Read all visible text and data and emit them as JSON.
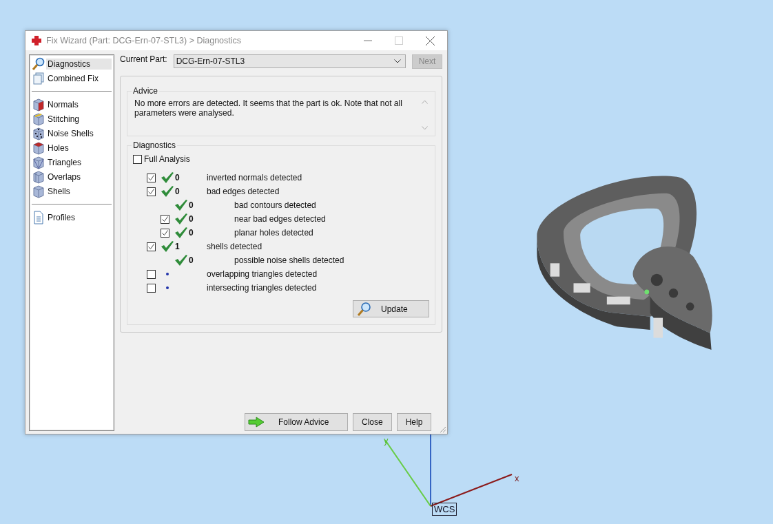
{
  "window": {
    "title": "Fix Wizard (Part: DCG-Ern-07-STL3) > Diagnostics"
  },
  "sidebar": {
    "groups": [
      {
        "items": [
          {
            "label": "Diagnostics",
            "selected": true
          },
          {
            "label": "Combined Fix",
            "selected": false
          }
        ]
      },
      {
        "items": [
          {
            "label": "Normals",
            "selected": false
          },
          {
            "label": "Stitching",
            "selected": false
          },
          {
            "label": "Noise Shells",
            "selected": false
          },
          {
            "label": "Holes",
            "selected": false
          },
          {
            "label": "Triangles",
            "selected": false
          },
          {
            "label": "Overlaps",
            "selected": false
          },
          {
            "label": "Shells",
            "selected": false
          }
        ]
      },
      {
        "items": [
          {
            "label": "Profiles",
            "selected": false
          }
        ]
      }
    ]
  },
  "current_part": {
    "label": "Current Part:",
    "value": "DCG-Ern-07-STL3"
  },
  "next_button": {
    "label": "Next",
    "disabled": true
  },
  "advice": {
    "title": "Advice",
    "text": "No more errors are detected. It seems that the part is ok. Note that not all parameters were analysed."
  },
  "diagnostics": {
    "title": "Diagnostics",
    "full_analysis": {
      "label": "Full Analysis",
      "checked": false
    },
    "rows": [
      {
        "checked": true,
        "passed": true,
        "count": "0",
        "label": "inverted normals detected"
      },
      {
        "checked": true,
        "passed": true,
        "count": "0",
        "label": "bad edges detected",
        "children": [
          {
            "passed": true,
            "count": "0",
            "label": "bad contours detected"
          },
          {
            "checked": true,
            "passed": true,
            "count": "0",
            "label": "near bad edges detected"
          },
          {
            "checked": true,
            "passed": true,
            "count": "0",
            "label": "planar holes detected"
          }
        ]
      },
      {
        "checked": true,
        "passed": true,
        "count": "1",
        "label": "shells detected",
        "children": [
          {
            "passed": true,
            "count": "0",
            "label": "possible noise shells detected"
          }
        ]
      },
      {
        "checked": false,
        "passed": false,
        "label": "overlapping triangles detected"
      },
      {
        "checked": false,
        "passed": false,
        "label": "intersecting triangles detected"
      }
    ]
  },
  "update_button": "Update",
  "buttons": [
    "Follow Advice",
    "Close",
    "Help"
  ],
  "viewport": {
    "axis_labels": [
      "x",
      "y"
    ],
    "wcs": "WCS"
  }
}
